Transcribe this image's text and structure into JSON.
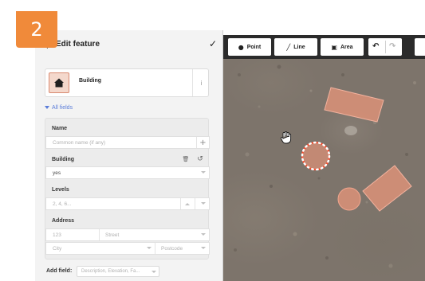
{
  "step_badge": {
    "number": "2"
  },
  "panel": {
    "title": "Edit feature",
    "done_glyph": "✓",
    "preset": {
      "label": "Building",
      "icon": "building-icon",
      "info_glyph": "i"
    },
    "all_fields": "All fields",
    "fields": {
      "name": {
        "label": "Name",
        "placeholder": "Common name (if any)",
        "add_glyph": "+"
      },
      "building": {
        "label": "Building",
        "value": "yes",
        "delete_glyph": "🗑",
        "revert_glyph": "↺"
      },
      "levels": {
        "label": "Levels",
        "placeholder": "2, 4, 6..."
      },
      "address": {
        "label": "Address",
        "number_placeholder": "123",
        "street_placeholder": "Street",
        "city_placeholder": "City",
        "postcode_placeholder": "Postcode"
      }
    },
    "add_field": {
      "label": "Add field:",
      "placeholder": "Description, Elevation, Fa..."
    }
  },
  "toolbar": {
    "point_label": "Point",
    "line_label": "Line",
    "area_label": "Area",
    "undo_glyph": "↶",
    "redo_glyph": "↷"
  },
  "colors": {
    "badge": "#f08a3a",
    "feature_fill": "#e8957a",
    "selected_outline": "#ff4a2a",
    "link": "#5b7dd9"
  }
}
